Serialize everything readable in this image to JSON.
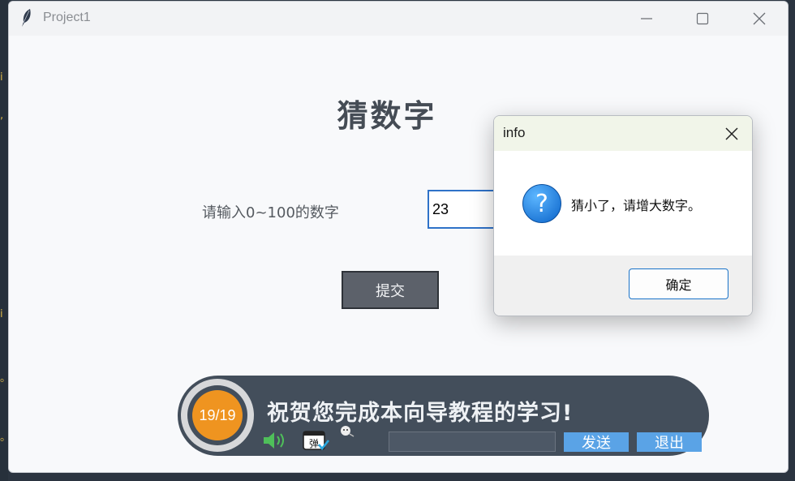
{
  "window": {
    "title": "Project1",
    "icon": "feather-icon",
    "controls": [
      "minimize-icon",
      "maximize-icon",
      "close-icon"
    ]
  },
  "main": {
    "heading": "猜数字",
    "prompt": "请输入0~100的数字",
    "input_value": "23",
    "submit_label": "提交"
  },
  "dialog": {
    "title": "info",
    "icon": "question-icon",
    "message": "猜小了，请增大数字。",
    "ok_label": "确定"
  },
  "banner": {
    "progress": "19/19",
    "message": "祝贺您完成本向导教程的学习!",
    "chat_input_value": "",
    "send_label": "发送",
    "exit_label": "退出",
    "icons": [
      "speaker-icon",
      "danmaku-icon",
      "emoji-icon"
    ]
  },
  "colors": {
    "accent_blue": "#2f72c8",
    "banner_bg": "#434e5b",
    "badge_orange": "#ef9420",
    "banner_button": "#5aa3e6"
  }
}
